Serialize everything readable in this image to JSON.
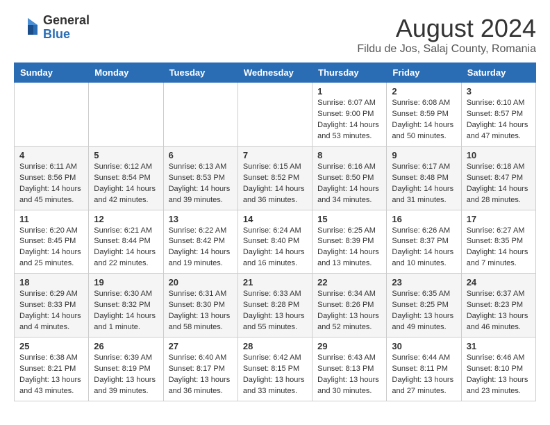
{
  "header": {
    "logo_general": "General",
    "logo_blue": "Blue",
    "month_title": "August 2024",
    "location": "Fildu de Jos, Salaj County, Romania"
  },
  "weekdays": [
    "Sunday",
    "Monday",
    "Tuesday",
    "Wednesday",
    "Thursday",
    "Friday",
    "Saturday"
  ],
  "weeks": [
    [
      {
        "day": "",
        "detail": ""
      },
      {
        "day": "",
        "detail": ""
      },
      {
        "day": "",
        "detail": ""
      },
      {
        "day": "",
        "detail": ""
      },
      {
        "day": "1",
        "detail": "Sunrise: 6:07 AM\nSunset: 9:00 PM\nDaylight: 14 hours\nand 53 minutes."
      },
      {
        "day": "2",
        "detail": "Sunrise: 6:08 AM\nSunset: 8:59 PM\nDaylight: 14 hours\nand 50 minutes."
      },
      {
        "day": "3",
        "detail": "Sunrise: 6:10 AM\nSunset: 8:57 PM\nDaylight: 14 hours\nand 47 minutes."
      }
    ],
    [
      {
        "day": "4",
        "detail": "Sunrise: 6:11 AM\nSunset: 8:56 PM\nDaylight: 14 hours\nand 45 minutes."
      },
      {
        "day": "5",
        "detail": "Sunrise: 6:12 AM\nSunset: 8:54 PM\nDaylight: 14 hours\nand 42 minutes."
      },
      {
        "day": "6",
        "detail": "Sunrise: 6:13 AM\nSunset: 8:53 PM\nDaylight: 14 hours\nand 39 minutes."
      },
      {
        "day": "7",
        "detail": "Sunrise: 6:15 AM\nSunset: 8:52 PM\nDaylight: 14 hours\nand 36 minutes."
      },
      {
        "day": "8",
        "detail": "Sunrise: 6:16 AM\nSunset: 8:50 PM\nDaylight: 14 hours\nand 34 minutes."
      },
      {
        "day": "9",
        "detail": "Sunrise: 6:17 AM\nSunset: 8:48 PM\nDaylight: 14 hours\nand 31 minutes."
      },
      {
        "day": "10",
        "detail": "Sunrise: 6:18 AM\nSunset: 8:47 PM\nDaylight: 14 hours\nand 28 minutes."
      }
    ],
    [
      {
        "day": "11",
        "detail": "Sunrise: 6:20 AM\nSunset: 8:45 PM\nDaylight: 14 hours\nand 25 minutes."
      },
      {
        "day": "12",
        "detail": "Sunrise: 6:21 AM\nSunset: 8:44 PM\nDaylight: 14 hours\nand 22 minutes."
      },
      {
        "day": "13",
        "detail": "Sunrise: 6:22 AM\nSunset: 8:42 PM\nDaylight: 14 hours\nand 19 minutes."
      },
      {
        "day": "14",
        "detail": "Sunrise: 6:24 AM\nSunset: 8:40 PM\nDaylight: 14 hours\nand 16 minutes."
      },
      {
        "day": "15",
        "detail": "Sunrise: 6:25 AM\nSunset: 8:39 PM\nDaylight: 14 hours\nand 13 minutes."
      },
      {
        "day": "16",
        "detail": "Sunrise: 6:26 AM\nSunset: 8:37 PM\nDaylight: 14 hours\nand 10 minutes."
      },
      {
        "day": "17",
        "detail": "Sunrise: 6:27 AM\nSunset: 8:35 PM\nDaylight: 14 hours\nand 7 minutes."
      }
    ],
    [
      {
        "day": "18",
        "detail": "Sunrise: 6:29 AM\nSunset: 8:33 PM\nDaylight: 14 hours\nand 4 minutes."
      },
      {
        "day": "19",
        "detail": "Sunrise: 6:30 AM\nSunset: 8:32 PM\nDaylight: 14 hours\nand 1 minute."
      },
      {
        "day": "20",
        "detail": "Sunrise: 6:31 AM\nSunset: 8:30 PM\nDaylight: 13 hours\nand 58 minutes."
      },
      {
        "day": "21",
        "detail": "Sunrise: 6:33 AM\nSunset: 8:28 PM\nDaylight: 13 hours\nand 55 minutes."
      },
      {
        "day": "22",
        "detail": "Sunrise: 6:34 AM\nSunset: 8:26 PM\nDaylight: 13 hours\nand 52 minutes."
      },
      {
        "day": "23",
        "detail": "Sunrise: 6:35 AM\nSunset: 8:25 PM\nDaylight: 13 hours\nand 49 minutes."
      },
      {
        "day": "24",
        "detail": "Sunrise: 6:37 AM\nSunset: 8:23 PM\nDaylight: 13 hours\nand 46 minutes."
      }
    ],
    [
      {
        "day": "25",
        "detail": "Sunrise: 6:38 AM\nSunset: 8:21 PM\nDaylight: 13 hours\nand 43 minutes."
      },
      {
        "day": "26",
        "detail": "Sunrise: 6:39 AM\nSunset: 8:19 PM\nDaylight: 13 hours\nand 39 minutes."
      },
      {
        "day": "27",
        "detail": "Sunrise: 6:40 AM\nSunset: 8:17 PM\nDaylight: 13 hours\nand 36 minutes."
      },
      {
        "day": "28",
        "detail": "Sunrise: 6:42 AM\nSunset: 8:15 PM\nDaylight: 13 hours\nand 33 minutes."
      },
      {
        "day": "29",
        "detail": "Sunrise: 6:43 AM\nSunset: 8:13 PM\nDaylight: 13 hours\nand 30 minutes."
      },
      {
        "day": "30",
        "detail": "Sunrise: 6:44 AM\nSunset: 8:11 PM\nDaylight: 13 hours\nand 27 minutes."
      },
      {
        "day": "31",
        "detail": "Sunrise: 6:46 AM\nSunset: 8:10 PM\nDaylight: 13 hours\nand 23 minutes."
      }
    ]
  ]
}
